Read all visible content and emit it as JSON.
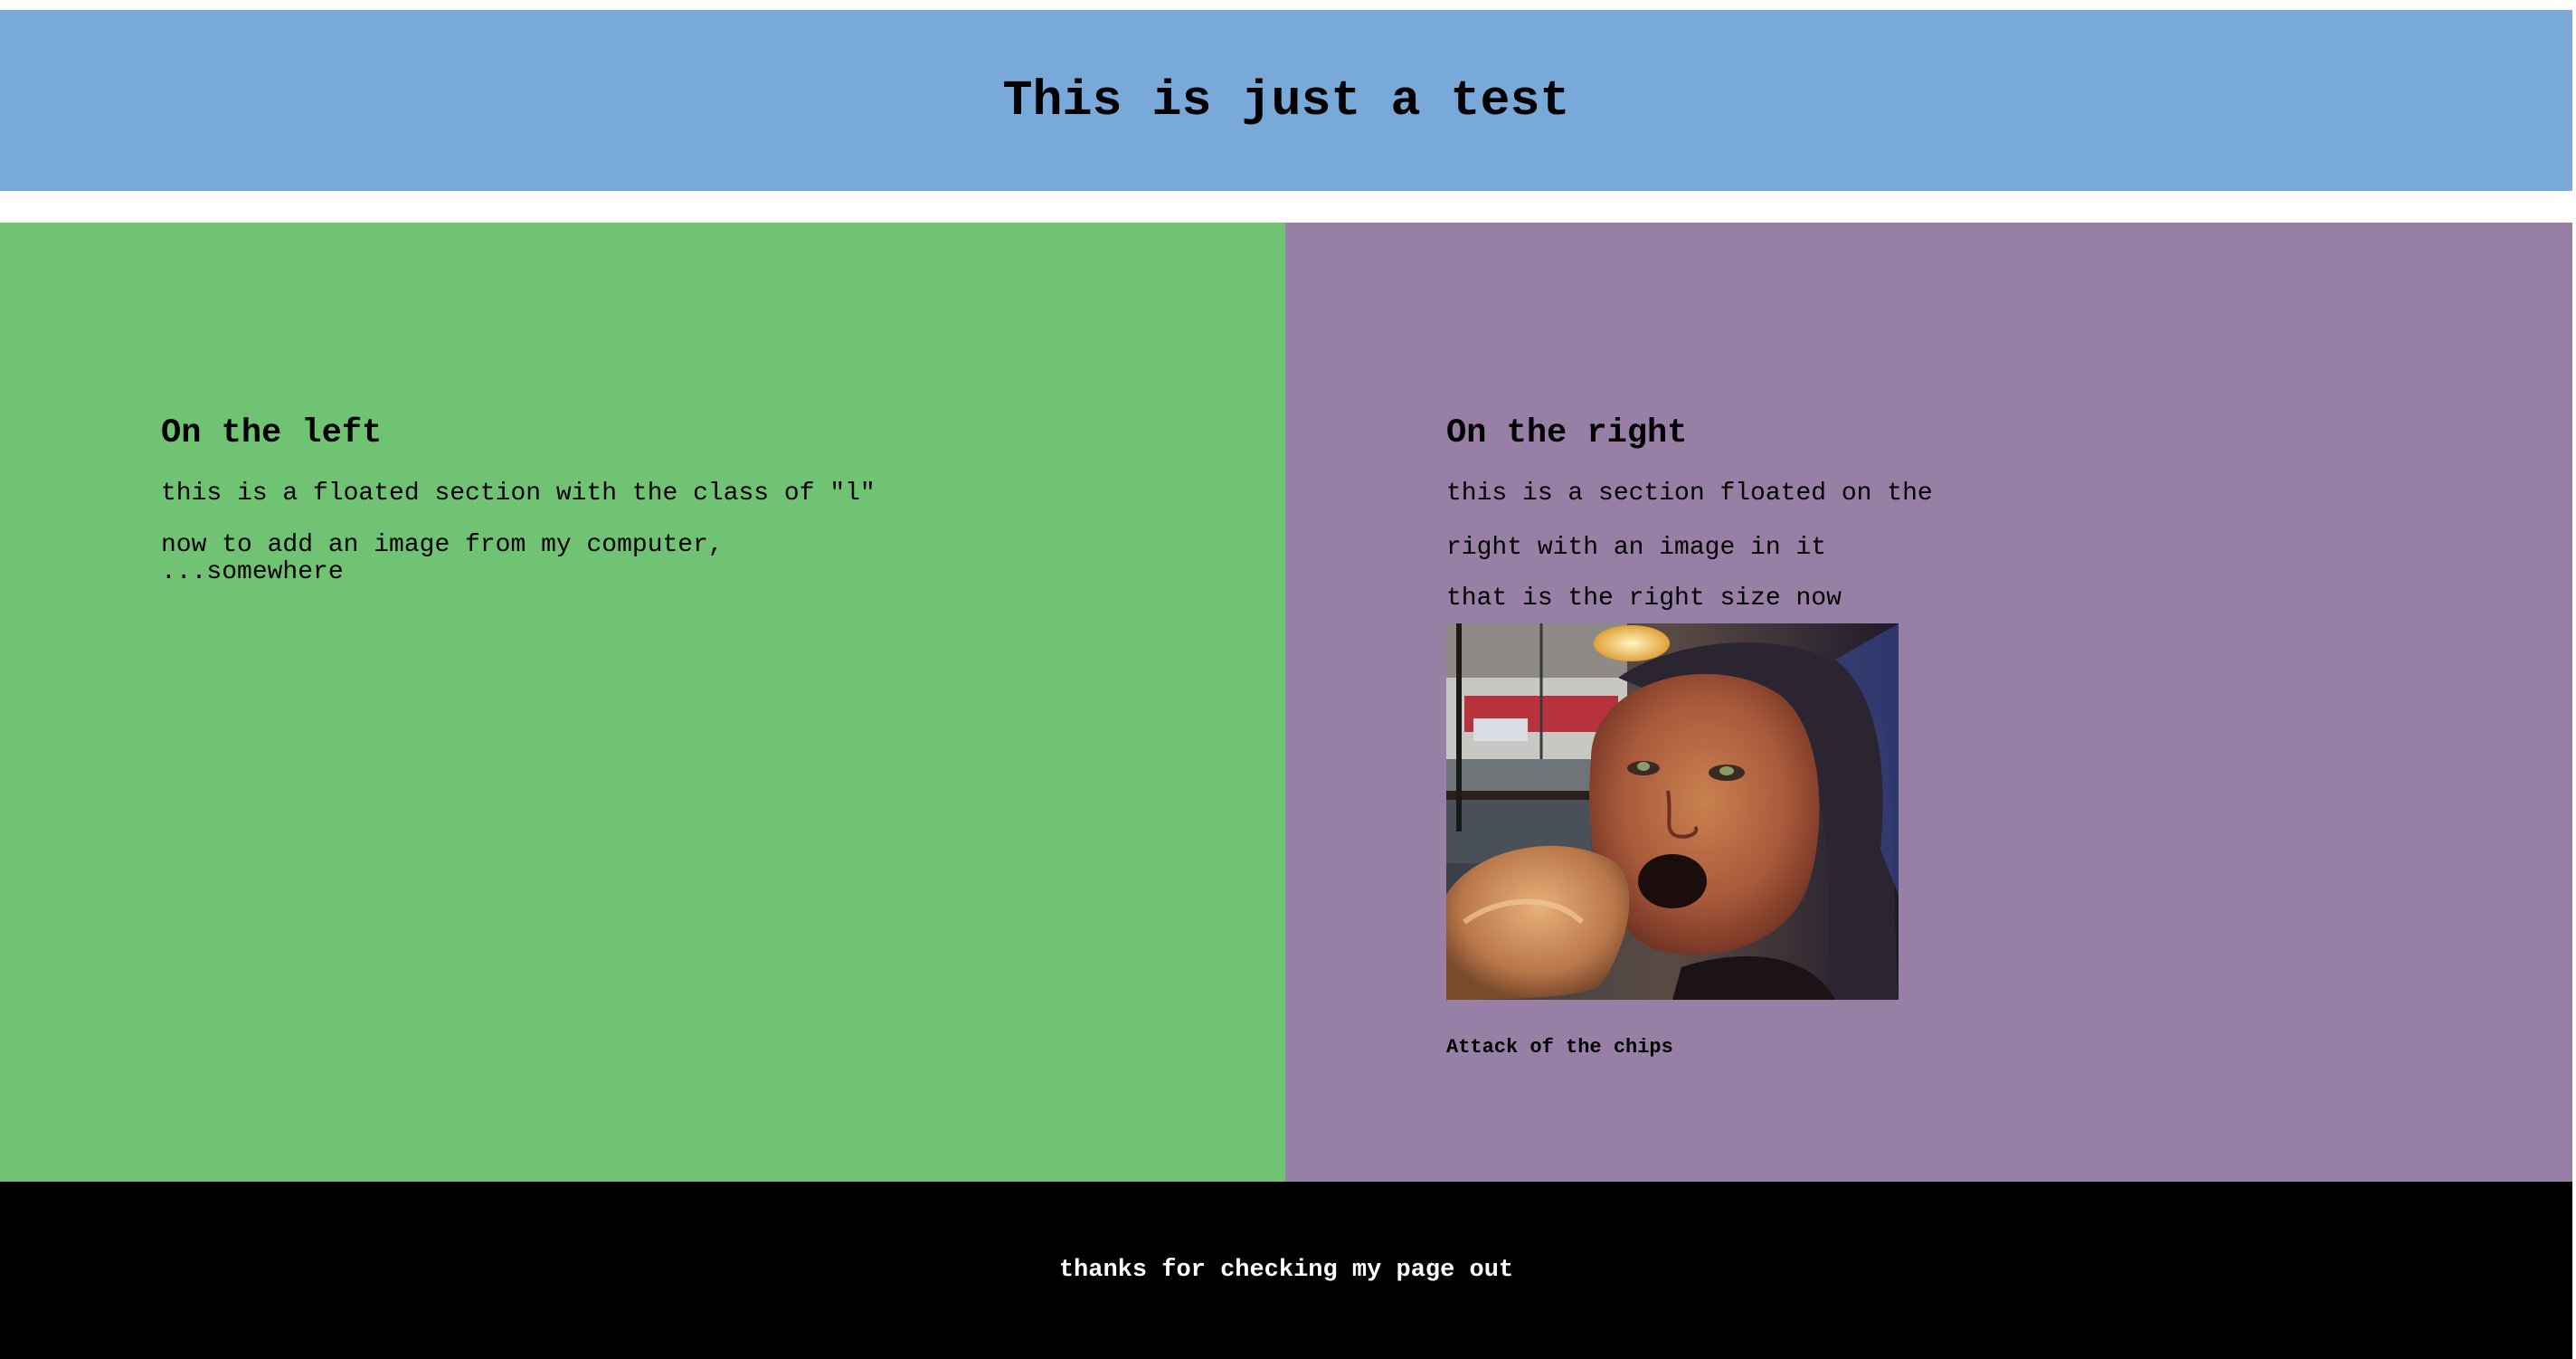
{
  "header": {
    "title": "This is just a test"
  },
  "left": {
    "title": "On the left",
    "para1": "this is a floated section with the class of \"l\"",
    "para2_line1": "now to add an image from my computer,",
    "para2_line2": "...somewhere"
  },
  "right": {
    "title": "On the right",
    "para1": "this is a section floated on the",
    "para2": "right with an image in it",
    "para3": "that is the right size now",
    "photo_caption": "Attack of the chips"
  },
  "footer": {
    "text": "thanks for checking my page out"
  },
  "colors": {
    "header_bg": "#79a9d9",
    "left_bg": "#71c374",
    "right_bg": "#987fa6",
    "footer_bg": "#000000"
  }
}
